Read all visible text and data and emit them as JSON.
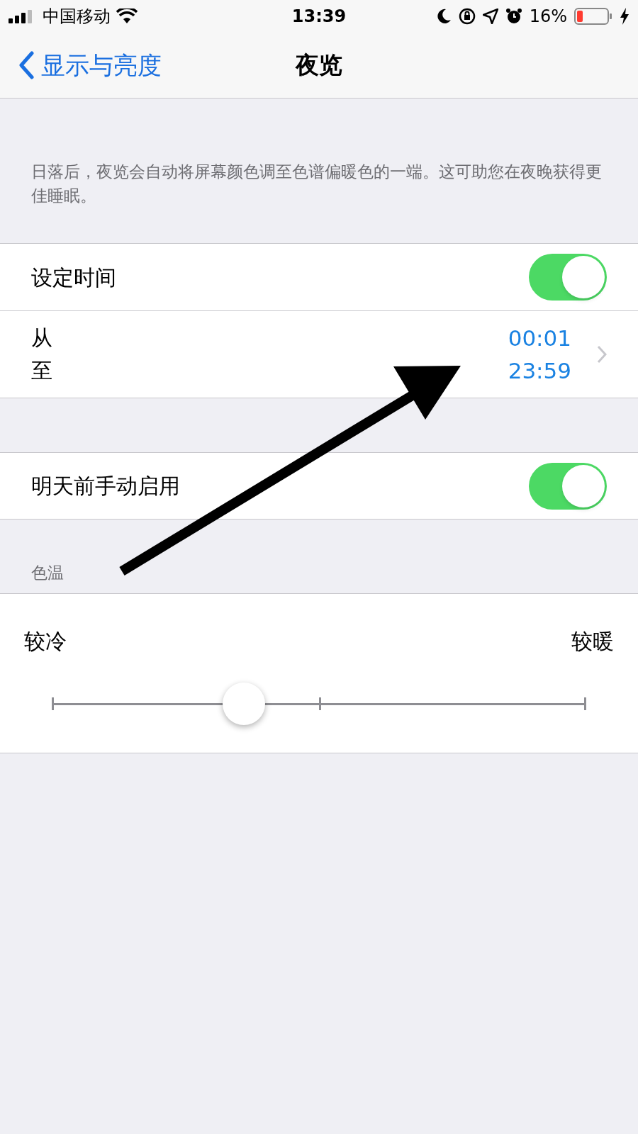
{
  "status_bar": {
    "carrier": "中国移动",
    "time": "13:39",
    "battery": "16%"
  },
  "nav": {
    "back": "显示与亮度",
    "title": "夜览"
  },
  "description": "日落后，夜览会自动将屏幕颜色调至色谱偏暖色的一端。这可助您在夜晚获得更佳睡眠。",
  "schedule": {
    "label": "设定时间",
    "on": true
  },
  "times": {
    "from_label": "从",
    "to_label": "至",
    "from": "00:01",
    "to": "23:59"
  },
  "manual": {
    "label": "明天前手动启用",
    "on": true
  },
  "temperature": {
    "header": "色温",
    "cooler": "较冷",
    "warmer": "较暖",
    "level": 0.36
  }
}
